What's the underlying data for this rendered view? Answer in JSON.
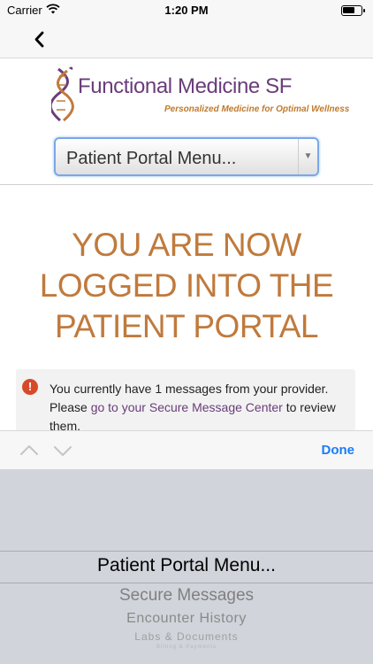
{
  "status_bar": {
    "carrier": "Carrier",
    "time": "1:20 PM",
    "battery_level": 0.7,
    "wifi_icon": "wifi-icon",
    "battery_icon": "battery-icon"
  },
  "nav": {
    "back_icon": "chevron-left-icon"
  },
  "logo": {
    "title": "Functional Medicine SF",
    "tagline": "Personalized Medicine for Optimal Wellness",
    "mark_icon": "dna-helix-icon"
  },
  "portal_select": {
    "value": "Patient Portal Menu...",
    "arrow_icon": "dropdown-arrow-icon"
  },
  "main": {
    "heading_lines": [
      "YOU ARE NOW",
      "LOGGED INTO THE",
      "PATIENT PORTAL"
    ],
    "alert": {
      "icon": "alert-icon",
      "icon_glyph": "!",
      "text_before": "You currently have 1 messages from your provider. Please ",
      "link_text": "go to your Secure Message Center",
      "text_after": " to review them."
    }
  },
  "accessory_bar": {
    "up_icon": "chevron-up-icon",
    "down_icon": "chevron-down-icon",
    "done_label": "Done"
  },
  "picker": {
    "selected_index": 0,
    "options": [
      "Patient Portal Menu...",
      "Secure Messages",
      "Encounter History",
      "Labs & Documents",
      "Billing & Payments"
    ]
  },
  "colors": {
    "brand_purple": "#6a3d7a",
    "brand_orange": "#c07a3c",
    "alert_red": "#d64a2a",
    "ios_blue": "#1a7df5"
  }
}
